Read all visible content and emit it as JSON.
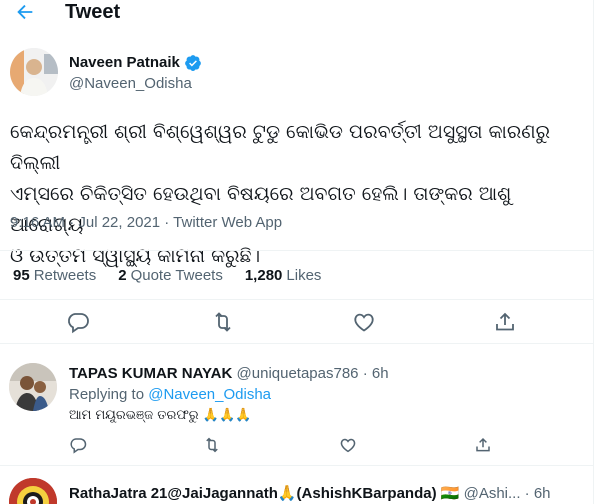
{
  "header": {
    "back_icon": "arrow-left-icon",
    "title": "Tweet"
  },
  "tweet": {
    "author_name": "Naveen Patnaik",
    "author_handle": "@Naveen_Odisha",
    "verified_icon": "verified-badge-icon",
    "text_line1": "କେନ୍ଦ୍ରମନ୍ତ୍ରୀ ଶ୍ରୀ ବିଶ୍ୱେଶ୍ୱର ଟୁଡୁ କୋଭିଡ ପରବର୍ତ୍ତୀ ଅସୁସ୍ଥତା କାରଣରୁ ଦିଲ୍ଲୀ",
    "text_line2": "ଏମ୍ସରେ ଚିକିତ୍ସିତ ହେଉଥିବା ବିଷୟରେ ଅବଗତ ହେଲି। ତାଙ୍କର ଆଶୁ ଆରୋଗ୍ୟ",
    "text_line3": "ଓ ଉତ୍ତମ ସ୍ୱାସ୍ଥ୍ୟ କାମନା କରୁଛି।",
    "meta": "9:16 AM · Jul 22, 2021 · Twitter Web App",
    "retweets_count": "95",
    "retweets_label": "Retweets",
    "quotes_count": "2",
    "quotes_label": "Quote Tweets",
    "likes_count": "1,280",
    "likes_label": "Likes",
    "action_icons": [
      "reply-icon",
      "retweet-icon",
      "like-icon",
      "share-icon"
    ]
  },
  "replies": [
    {
      "author_name": "TAPAS KUMAR NAYAK",
      "author_handle": "@uniquetapas786 · 6h",
      "replying_prefix": "Replying to ",
      "replying_handle": "@Naveen_Odisha",
      "text": "ଆମ ମୟୂରଭଞ୍ଜ ତରଫରୁ 🙏🙏🙏"
    },
    {
      "author_name": "RathaJatra 21@JaiJagannath🙏(AshishKBarpanda) 🇮🇳",
      "author_handle": "@Ashi... · 6h"
    }
  ],
  "colors": {
    "accent": "#1d9bf0",
    "text_primary": "#0f1419",
    "text_secondary": "#536471",
    "divider": "#eff3f4"
  }
}
